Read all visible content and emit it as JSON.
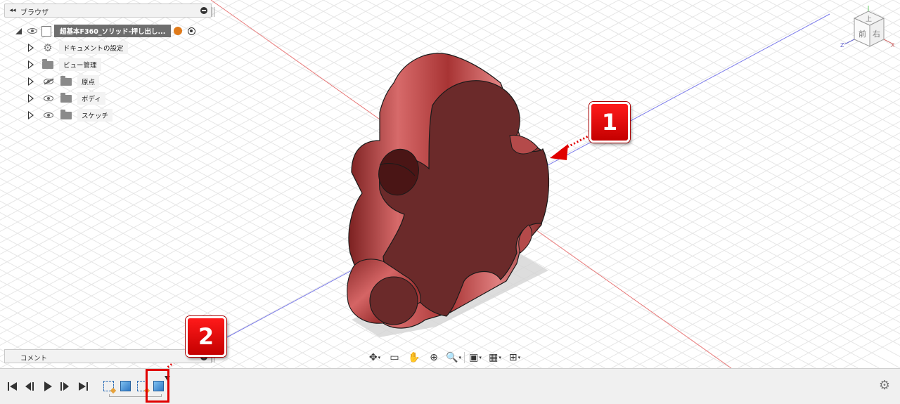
{
  "browser": {
    "title": "ブラウザ",
    "root": {
      "label": "超基本F360_ソリッド-押し出し..."
    },
    "items": [
      {
        "label": "ドキュメントの設定",
        "icon": "gear-icon"
      },
      {
        "label": "ビュー管理",
        "icon": "folder-icon"
      },
      {
        "label": "原点",
        "icon": "folder-icon",
        "visibility": "hidden"
      },
      {
        "label": "ボディ",
        "icon": "folder-icon",
        "visibility": "visible"
      },
      {
        "label": "スケッチ",
        "icon": "folder-icon",
        "visibility": "visible"
      }
    ]
  },
  "comments": {
    "title": "コメント"
  },
  "viewcube": {
    "top": "上",
    "front": "前",
    "right": "右",
    "axis_x": "X",
    "axis_z": "Z"
  },
  "callouts": {
    "one": "1",
    "two": "2"
  },
  "colors": {
    "body": "#a83a3a",
    "callout": "#e00000",
    "axis_red": "#e06060",
    "axis_blue": "#6a6ae0"
  }
}
